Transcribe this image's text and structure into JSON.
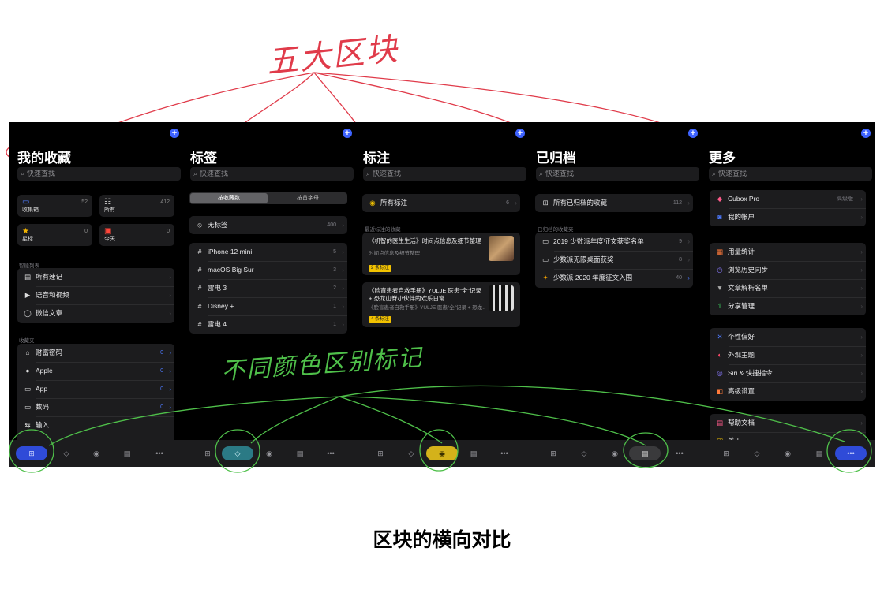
{
  "annotations": {
    "top_red": "五大区块",
    "middle_green": "不同颜色区别标记",
    "caption": "区块的横向对比"
  },
  "colors": {
    "accent_blue": "#3e63ff",
    "tab_blue": "#2f4bd8",
    "tab_teal": "#2b7a85",
    "tab_yellow": "#d4b21a",
    "tab_gray": "#3a3a3c",
    "annot_red": "#e03b4a",
    "annot_green": "#4fc04a"
  },
  "panels": {
    "favorites": {
      "title": "我的收藏",
      "search": "快速查找",
      "tiles": [
        {
          "label": "收集箱",
          "count": "52",
          "icon": "inbox-icon"
        },
        {
          "label": "所有",
          "count": "412",
          "icon": "list-icon"
        },
        {
          "label": "星标",
          "count": "0",
          "icon": "star-icon"
        },
        {
          "label": "今天",
          "count": "0",
          "icon": "calendar-icon"
        }
      ],
      "smart_header": "智能列表",
      "smart_items": [
        {
          "label": "所有速记",
          "icon": "note-icon"
        },
        {
          "label": "语音和视频",
          "icon": "play-icon"
        },
        {
          "label": "微信文章",
          "icon": "chat-icon"
        }
      ],
      "folder_header": "收藏夹",
      "folders": [
        {
          "label": "财富密码",
          "count": "0",
          "icon": "bank-icon"
        },
        {
          "label": "Apple",
          "count": "0",
          "icon": "apple-icon"
        },
        {
          "label": "App",
          "count": "0",
          "icon": "folder-icon"
        },
        {
          "label": "数码",
          "count": "0",
          "icon": "folder-icon"
        },
        {
          "label": "输入",
          "count": "",
          "icon": "input-icon"
        }
      ]
    },
    "tags": {
      "title": "标签",
      "search": "快速查找",
      "seg_on": "按收藏数",
      "seg_off": "按首字母",
      "untagged": {
        "label": "无标签",
        "count": "400"
      },
      "items": [
        {
          "label": "iPhone 12 mini",
          "count": "5"
        },
        {
          "label": "macOS Big Sur",
          "count": "3"
        },
        {
          "label": "雷电 3",
          "count": "2"
        },
        {
          "label": "Disney +",
          "count": "1"
        },
        {
          "label": "雷电 4",
          "count": "1"
        }
      ]
    },
    "annotations": {
      "title": "标注",
      "search": "快速查找",
      "all": {
        "label": "所有标注",
        "count": "6"
      },
      "recent_header": "最近标注的收藏",
      "cards": [
        {
          "title": "《机智的医生生活》时间点信息及细节整理",
          "sub": "时间点信息及细节整理",
          "tag": "2 条标注"
        },
        {
          "title": "《脸盲患者自救手册》YULJE 医患“全”记录 + 恐龙山脊小伙伴的欢乐日常",
          "sub": "《脸盲患者自救手册》YULJE 医患“全”记录 + 恐龙...",
          "tag": "4 条标注"
        }
      ]
    },
    "archive": {
      "title": "已归档",
      "search": "快速查找",
      "all": {
        "label": "所有已归档的收藏",
        "count": "112"
      },
      "folder_header": "已归档的收藏夹",
      "items": [
        {
          "label": "2019 少数派年度征文获奖名单",
          "count": "9",
          "icon": "folder-icon"
        },
        {
          "label": "少数派无限桌面获奖",
          "count": "8",
          "icon": "folder-icon"
        },
        {
          "label": "少数派 2020 年度征文入围",
          "count": "40",
          "icon": "party-icon"
        }
      ]
    },
    "more": {
      "title": "更多",
      "search": "快速查找",
      "pro": {
        "label": "Cubox Pro",
        "note": "高级版"
      },
      "account": "我的帐户",
      "group2": [
        "用量统计",
        "浏览历史同步",
        "文章解析名单",
        "分享管理"
      ],
      "group3": [
        "个性偏好",
        "外观主题",
        "Siri & 快捷指令",
        "高级设置"
      ],
      "group4": [
        "帮助文档",
        "关于"
      ]
    }
  },
  "tabbar": {
    "more_label": "•••"
  }
}
